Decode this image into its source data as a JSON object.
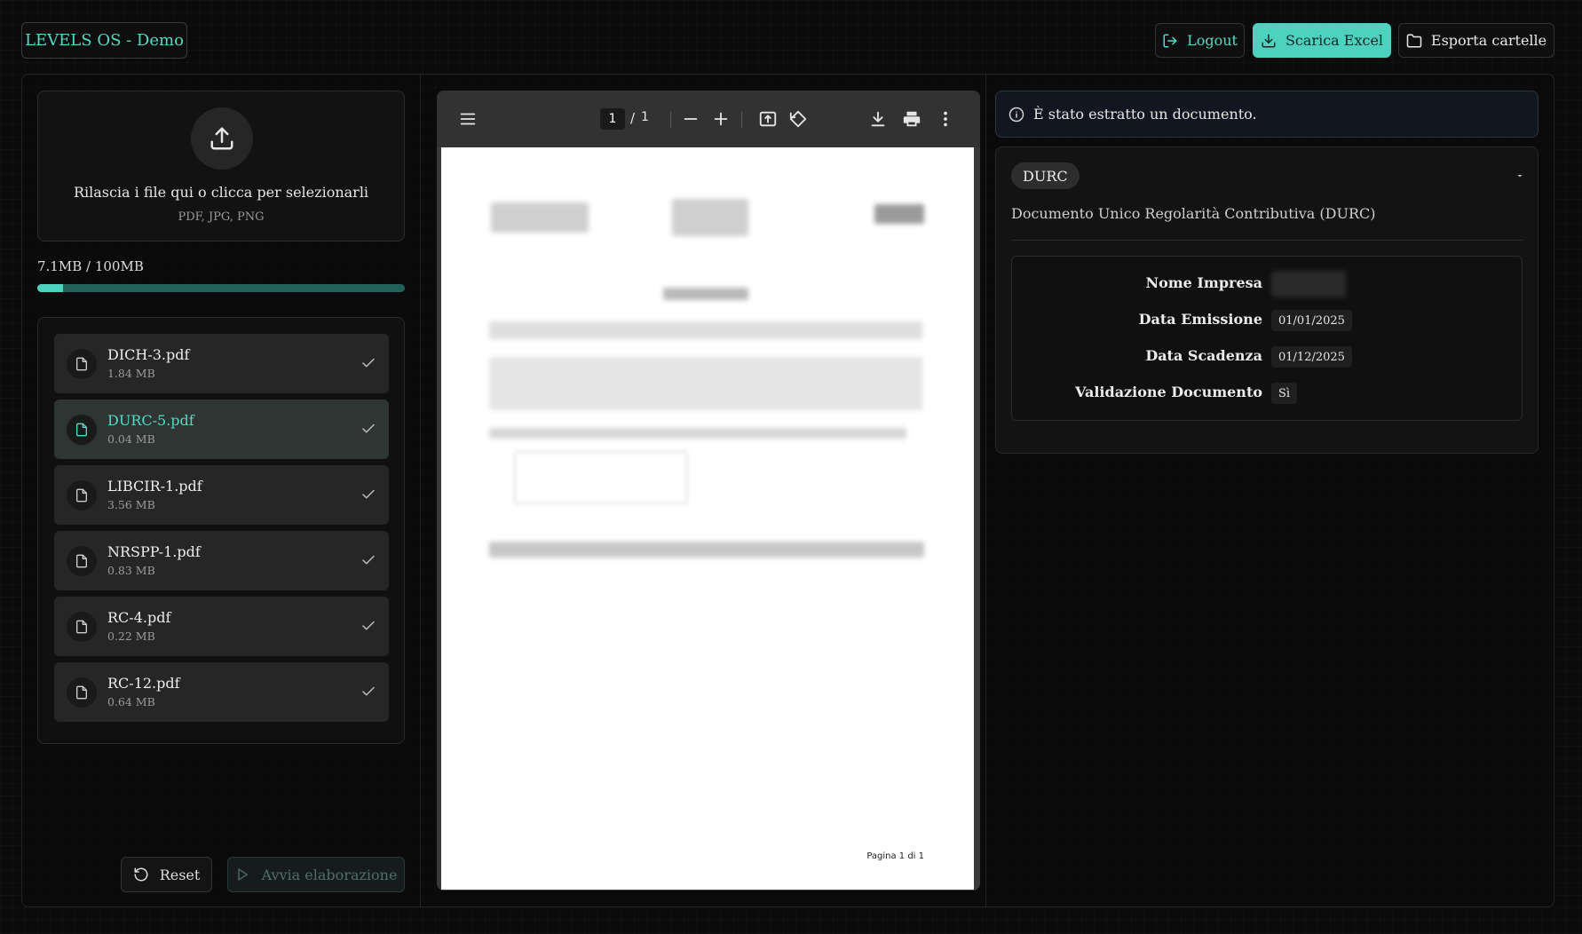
{
  "header": {
    "brand": "LEVELS OS - Demo",
    "logout_label": "Logout",
    "excel_label": "Scarica Excel",
    "export_label": "Esporta cartelle",
    "accent_color": "#4fd1bf"
  },
  "upload": {
    "title": "Rilascia i file qui o clicca per selezionarli",
    "formats": "PDF, JPG, PNG",
    "icon": "upload-icon"
  },
  "storage": {
    "label": "7.1MB / 100MB",
    "used_mb": 7.1,
    "total_mb": 100
  },
  "files": [
    {
      "name": "DICH-3.pdf",
      "size": "1.84 MB",
      "active": false
    },
    {
      "name": "DURC-5.pdf",
      "size": "0.04 MB",
      "active": true
    },
    {
      "name": "LIBCIR-1.pdf",
      "size": "3.56 MB",
      "active": false
    },
    {
      "name": "NRSPP-1.pdf",
      "size": "0.83 MB",
      "active": false
    },
    {
      "name": "RC-4.pdf",
      "size": "0.22 MB",
      "active": false
    },
    {
      "name": "RC-12.pdf",
      "size": "0.64 MB",
      "active": false
    }
  ],
  "actions": {
    "reset_label": "Reset",
    "run_label": "Avvia elaborazione"
  },
  "viewer": {
    "current_page": "1",
    "separator": "/",
    "total_pages": "1",
    "footer": "Pagina 1 di 1"
  },
  "result": {
    "info_message": "È stato estratto un documento.",
    "doc_type": "DURC",
    "doc_title": "Documento Unico Regolarità Contributiva (DURC)",
    "fields": [
      {
        "label": "Nome Impresa",
        "value": ""
      },
      {
        "label": "Data Emissione",
        "value": "01/01/2025"
      },
      {
        "label": "Data Scadenza",
        "value": "01/12/2025"
      },
      {
        "label": "Validazione Documento",
        "value": "Sì"
      }
    ]
  }
}
